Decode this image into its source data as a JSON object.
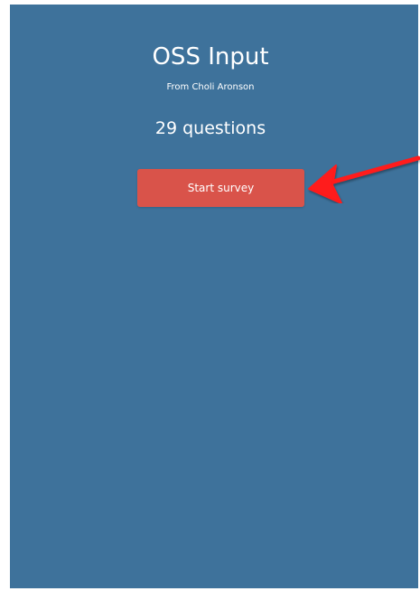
{
  "survey": {
    "title": "OSS Input",
    "author": "From Choli Aronson",
    "question_count": "29 questions",
    "start_label": "Start survey"
  },
  "colors": {
    "panel_background": "#3e729b",
    "start_button": "#d9534a",
    "annotation_arrow": "#ff1a1a",
    "text": "#ffffff"
  },
  "annotation": {
    "icon": "red-arrow-icon",
    "points_to": "start-survey-button"
  }
}
